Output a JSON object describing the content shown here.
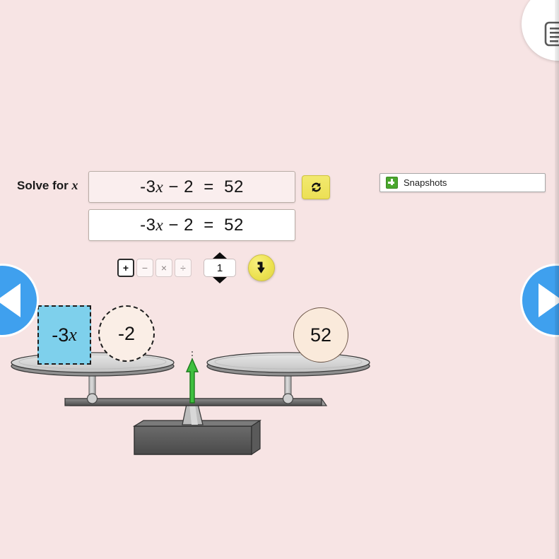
{
  "background_color": "#f7e4e4",
  "accent_blue": "#3fa0ee",
  "accent_yellow": "#ece14f",
  "tile_blue": "#7ed0ec",
  "tile_cream": "#faeee6",
  "toolbar": {
    "media_button_name": "presentation-icon"
  },
  "nav": {
    "prev_label": "Previous",
    "next_label": "Next"
  },
  "prompt": {
    "label_prefix": "Solve for ",
    "variable": "x"
  },
  "equations": {
    "original": {
      "lhs_coef": "-3",
      "lhs_var": "x",
      "lhs_rest": " − 2",
      "equals": "=",
      "rhs": "52",
      "full": "-3x − 2  =  52"
    },
    "working": {
      "lhs_coef": "-3",
      "lhs_var": "x",
      "lhs_rest": " − 2",
      "equals": "=",
      "rhs": "52",
      "full": "-3x − 2  =  52"
    }
  },
  "reset_button": {
    "label": "Reset",
    "icon": "refresh-icon"
  },
  "operator_bar": {
    "buttons": [
      {
        "symbol": "+",
        "name": "plus",
        "selected": true
      },
      {
        "symbol": "−",
        "name": "minus",
        "selected": false
      },
      {
        "symbol": "×",
        "name": "multiply",
        "selected": false
      },
      {
        "symbol": "÷",
        "name": "divide",
        "selected": false
      }
    ],
    "operand": "1",
    "apply_icon": "apply-arrow-icon"
  },
  "snapshots": {
    "label": "Snapshots",
    "icon": "green-plus-icon"
  },
  "balance": {
    "left_pan_items": [
      {
        "text": "-3",
        "variable": "x",
        "shape": "square",
        "border": "dashed",
        "color": "#7ed0ec"
      },
      {
        "text": "-2",
        "variable": "",
        "shape": "circle",
        "border": "dashed",
        "color": "#faeee6"
      }
    ],
    "right_pan_items": [
      {
        "text": "52",
        "variable": "",
        "shape": "circle",
        "border": "solid",
        "color": "#faeadb"
      }
    ],
    "pointer_color": "#2fb52f",
    "state": "balanced"
  }
}
